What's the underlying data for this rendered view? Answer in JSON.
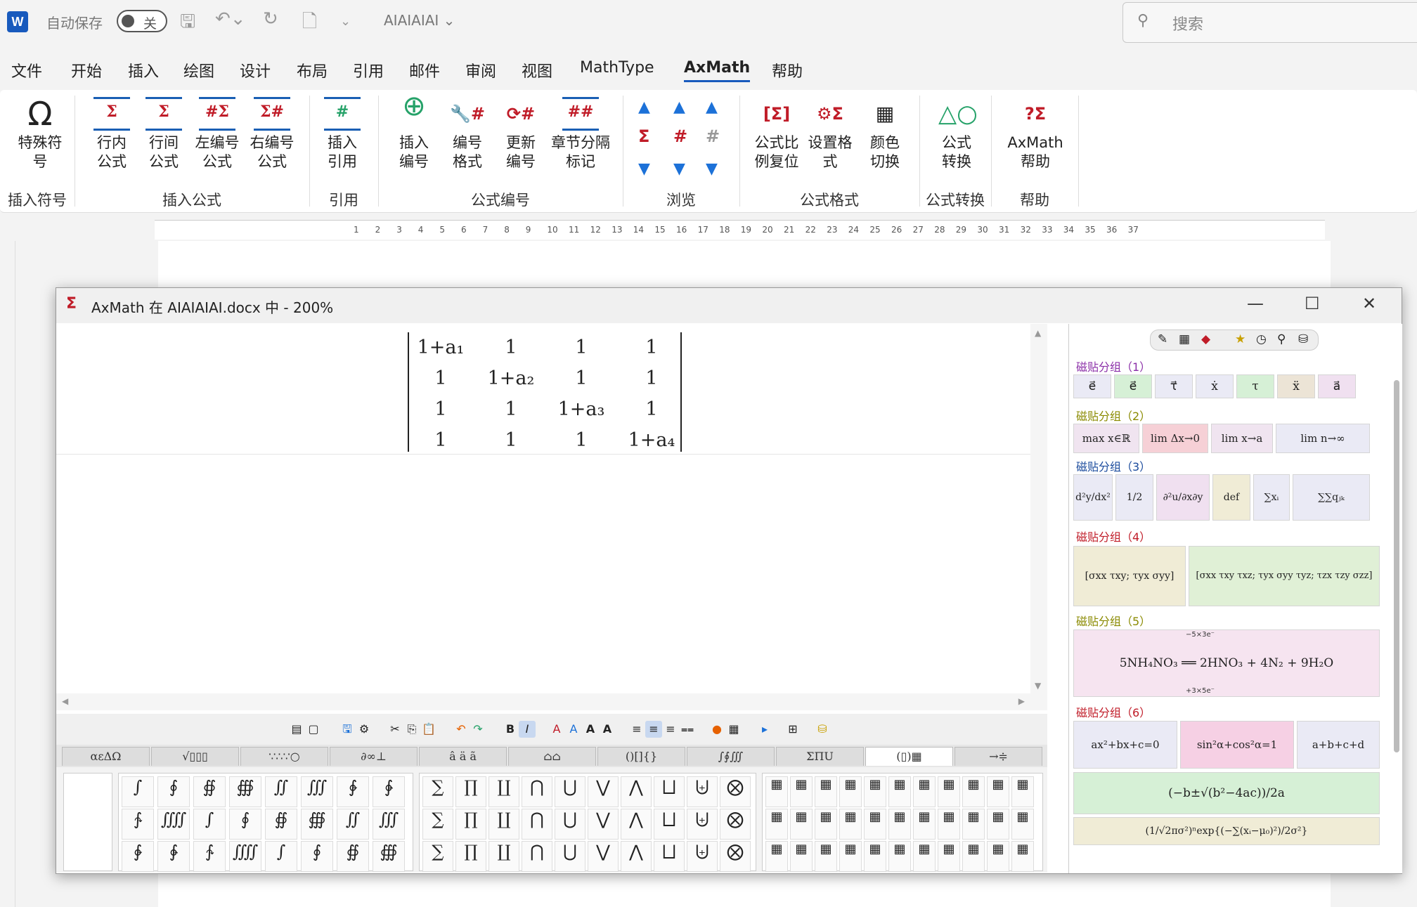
{
  "titlebar": {
    "autosave": "自动保存",
    "toggle": "关",
    "docname": "AIAIAIAI",
    "search": "搜索"
  },
  "menu": [
    "文件",
    "开始",
    "插入",
    "绘图",
    "设计",
    "布局",
    "引用",
    "邮件",
    "审阅",
    "视图",
    "MathType",
    "AxMath",
    "帮助"
  ],
  "ribbon": {
    "buttons": [
      "特殊符号",
      "行内公式",
      "行间公式",
      "左编号公式",
      "右编号公式",
      "插入引用",
      "插入编号",
      "编号格式",
      "更新编号",
      "章节分隔标记",
      "公式比例复位",
      "设置格式",
      "颜色切换",
      "公式转换",
      "AxMath帮助"
    ],
    "groups": [
      "插入符号",
      "插入公式",
      "引用",
      "公式编号",
      "浏览",
      "公式格式",
      "公式转换",
      "帮助"
    ]
  },
  "ruler": {
    "numbers": [
      "1",
      "2",
      "3",
      "4",
      "5",
      "6",
      "7",
      "8",
      "9",
      "10",
      "11",
      "12",
      "13",
      "14",
      "15",
      "16",
      "17",
      "18",
      "19",
      "20",
      "21",
      "22",
      "23",
      "24",
      "25",
      "26",
      "27",
      "28",
      "29",
      "30",
      "31",
      "32",
      "33",
      "34",
      "35",
      "36",
      "37"
    ]
  },
  "axmath": {
    "title": "AxMath 在 AIAIAIAI.docx 中 - 200%",
    "matrix": [
      [
        "1+a₁",
        "1",
        "1",
        "1"
      ],
      [
        "1",
        "1+a₂",
        "1",
        "1"
      ],
      [
        "1",
        "1",
        "1+a₃",
        "1"
      ],
      [
        "1",
        "1",
        "1",
        "1+a₄"
      ]
    ],
    "tabs": [
      "αεΔΩ",
      "√▯▯▯",
      "∵∴∵○",
      "∂∞⊥",
      "â ä ã",
      "⌂⌂",
      "()[]{}",
      "∫∮∭",
      "ΣΠU",
      "(▯)▦",
      "→≑"
    ],
    "palette_ops": [
      "∑",
      "∏",
      "∐",
      "⋂",
      "⋃",
      "⋁",
      "⋀",
      "⨆",
      "⨄",
      "⨂"
    ],
    "palette_int": [
      "∫",
      "∮",
      "∯",
      "∰",
      "∬",
      "∭",
      "∲",
      "∳",
      "∱",
      "⨌"
    ],
    "groups": [
      "磁贴分组（1）",
      "磁贴分组（2）",
      "磁贴分组（3）",
      "磁贴分组（4）",
      "磁贴分组（5）",
      "磁贴分组（6）"
    ],
    "group_colors": [
      "#8b2fa8",
      "#8a8a00",
      "#1a4a9c",
      "#c01c28",
      "#8a8a00",
      "#c01c28"
    ],
    "tiles1": [
      "e⃗",
      "e⃗",
      "τ⃗",
      "ẋ",
      "τ",
      "ẍ",
      "a⃗"
    ],
    "tiles2": [
      "max x∈ℝ",
      "lim Δx→0",
      "lim x→a",
      "lim n→∞"
    ],
    "tiles3": [
      "d²y/dx²",
      "1/2",
      "∂²u/∂x∂y",
      "def",
      "∑xᵢ",
      "∑∑qⱼₖ"
    ],
    "tiles4": [
      "[σxx τxy; τyx σyy]",
      "[σxx τxy τxz; τyx σyy τyz; τzx τzy σzz]"
    ],
    "tile5": "5NH₄NO₃ ══ 2HNO₃ + 4N₂ + 9H₂O",
    "tile5_top": "−5×3e⁻",
    "tile5_bot": "+3×5e⁻",
    "tiles6": [
      "ax²+bx+c=0",
      "sin²α+cos²α=1",
      "a+b+c+d",
      "(−b±√(b²−4ac))/2a",
      "(1/√2πσ²)ⁿexp{(−∑(xᵢ−μ₀)²)/2σ²}"
    ]
  },
  "colors": {
    "accent": "#185abd",
    "red": "#c01c28",
    "blue": "#1c71d8"
  }
}
